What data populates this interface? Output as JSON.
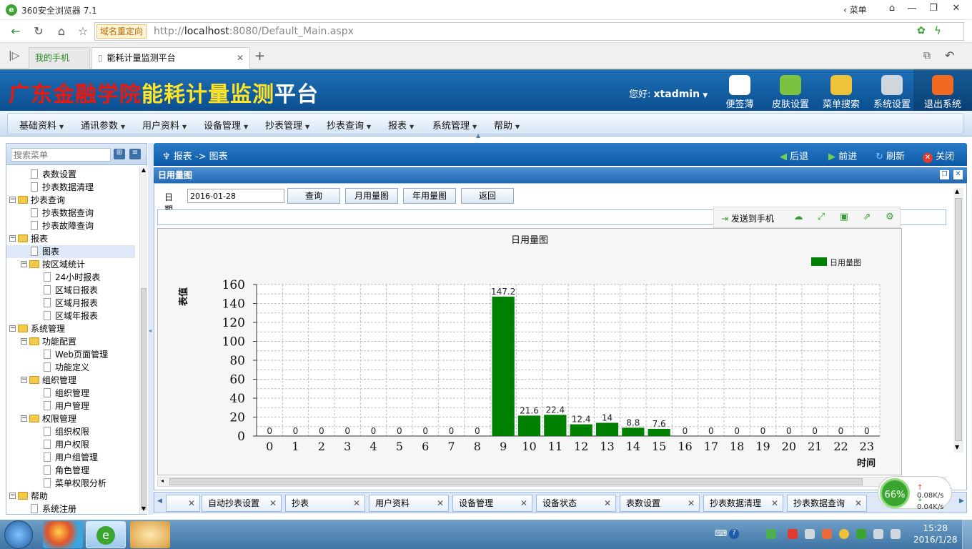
{
  "browser": {
    "title": "360安全浏览器 7.1",
    "menu_label": "菜单",
    "redirect_badge": "域名重定向",
    "url_prefix": "http://",
    "url_host": "localhost",
    "url_rest": ":8080/Default_Main.aspx",
    "tabs": [
      {
        "label": "我的手机"
      },
      {
        "label": "能耗计量监测平台"
      }
    ]
  },
  "header": {
    "title_part1": "广东金融学院",
    "title_part2": "能耗计量监测",
    "title_part3": "平台",
    "greeting": "您好:",
    "username": "xtadmin",
    "buttons": [
      {
        "label": "便签薄",
        "icon": "notepad-icon",
        "color": "#ffffff"
      },
      {
        "label": "皮肤设置",
        "icon": "heart-icon",
        "color": "#7cc242"
      },
      {
        "label": "菜单搜索",
        "icon": "magnifier-icon",
        "color": "#f0c23a"
      },
      {
        "label": "系统设置",
        "icon": "gear-icon",
        "color": "#cfd6de"
      },
      {
        "label": "退出系统",
        "icon": "power-icon",
        "color": "#f26a22"
      }
    ]
  },
  "menu": [
    "基础资料",
    "通讯参数",
    "用户资料",
    "设备管理",
    "抄表管理",
    "抄表查询",
    "报表",
    "系统管理",
    "帮助"
  ],
  "sidebar": {
    "search_placeholder": "搜索菜单",
    "tree": [
      {
        "label": "表数设置",
        "level": 2,
        "type": "doc"
      },
      {
        "label": "抄表数据清理",
        "level": 2,
        "type": "doc"
      },
      {
        "label": "抄表查询",
        "level": 1,
        "type": "folder"
      },
      {
        "label": "抄表数据查询",
        "level": 2,
        "type": "doc"
      },
      {
        "label": "抄表故障查询",
        "level": 2,
        "type": "doc"
      },
      {
        "label": "报表",
        "level": 1,
        "type": "folder"
      },
      {
        "label": "图表",
        "level": 2,
        "type": "doc",
        "selected": true
      },
      {
        "label": "按区域统计",
        "level": 2,
        "type": "folder"
      },
      {
        "label": "24小时报表",
        "level": 3,
        "type": "doc"
      },
      {
        "label": "区域日报表",
        "level": 3,
        "type": "doc"
      },
      {
        "label": "区域月报表",
        "level": 3,
        "type": "doc"
      },
      {
        "label": "区域年报表",
        "level": 3,
        "type": "doc"
      },
      {
        "label": "系统管理",
        "level": 1,
        "type": "folder"
      },
      {
        "label": "功能配置",
        "level": 2,
        "type": "folder"
      },
      {
        "label": "Web页面管理",
        "level": 3,
        "type": "doc"
      },
      {
        "label": "功能定义",
        "level": 3,
        "type": "doc"
      },
      {
        "label": "组织管理",
        "level": 2,
        "type": "folder"
      },
      {
        "label": "组织管理",
        "level": 3,
        "type": "doc"
      },
      {
        "label": "用户管理",
        "level": 3,
        "type": "doc"
      },
      {
        "label": "权限管理",
        "level": 2,
        "type": "folder"
      },
      {
        "label": "组织权限",
        "level": 3,
        "type": "doc"
      },
      {
        "label": "用户权限",
        "level": 3,
        "type": "doc"
      },
      {
        "label": "用户组管理",
        "level": 3,
        "type": "doc"
      },
      {
        "label": "角色管理",
        "level": 3,
        "type": "doc"
      },
      {
        "label": "菜单权限分析",
        "level": 3,
        "type": "doc"
      },
      {
        "label": "帮助",
        "level": 1,
        "type": "folder"
      },
      {
        "label": "系统注册",
        "level": 2,
        "type": "doc"
      }
    ]
  },
  "main": {
    "breadcrumb": "报表 -> 图表",
    "nav": {
      "back": "后退",
      "forward": "前进",
      "refresh": "刷新",
      "close": "关闭"
    },
    "panel_title": "日用量图",
    "query": {
      "date_label": "日期",
      "date_value": "2016-01-28",
      "query_btn": "查询",
      "month_btn": "月用量图",
      "year_btn": "年用量图",
      "back_btn": "返回"
    },
    "chart_toolbar": {
      "send_label": "发送到手机"
    }
  },
  "chart_data": {
    "type": "bar",
    "title": "日用量图",
    "xlabel": "时间",
    "ylabel": "表值",
    "legend": "日用量图",
    "legend_position": "top-right",
    "categories": [
      "0",
      "1",
      "2",
      "3",
      "4",
      "5",
      "6",
      "7",
      "8",
      "9",
      "10",
      "11",
      "12",
      "13",
      "14",
      "15",
      "16",
      "17",
      "18",
      "19",
      "20",
      "21",
      "22",
      "23"
    ],
    "values": [
      0,
      0,
      0,
      0,
      0,
      0,
      0,
      0,
      0,
      147.2,
      21.6,
      22.4,
      12.4,
      14,
      8.8,
      7.6,
      0,
      0,
      0,
      0,
      0,
      0,
      0,
      0
    ],
    "ylim": [
      0,
      160
    ],
    "yticks": [
      0,
      20,
      40,
      60,
      80,
      100,
      120,
      140,
      160
    ],
    "bar_color": "#008000",
    "grid": true
  },
  "bottom_tabs": [
    "",
    "自动抄表设置",
    "抄表",
    "用户资料",
    "设备管理",
    "设备状态",
    "表数设置",
    "抄表数据清理",
    "抄表数据查询"
  ],
  "network": {
    "percent": "66%",
    "up": "0.08K/s",
    "down": "0.04K/s"
  },
  "taskbar": {
    "time": "15:28",
    "date": "2016/1/28"
  }
}
